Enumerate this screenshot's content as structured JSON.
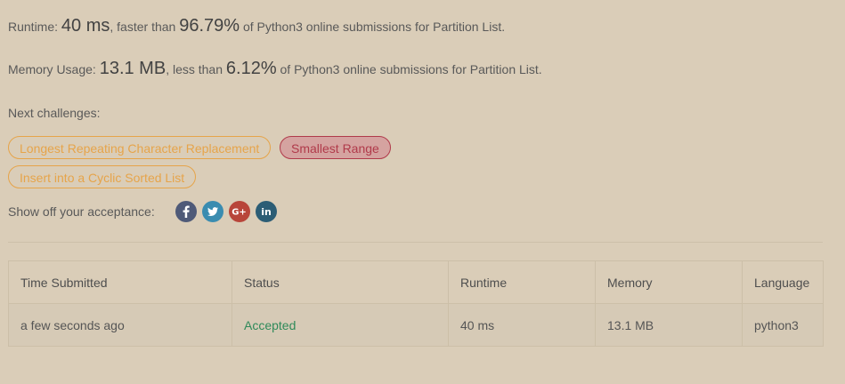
{
  "runtime_line": {
    "label": "Runtime:",
    "value": "40 ms",
    "mid": ", faster than",
    "percent": "96.79%",
    "suffix": "of Python3 online submissions for Partition List."
  },
  "memory_line": {
    "label": "Memory Usage:",
    "value": "13.1 MB",
    "mid": ", less than",
    "percent": "6.12%",
    "suffix": "of Python3 online submissions for Partition List."
  },
  "next": {
    "label": "Next challenges:",
    "challenges": [
      {
        "title": "Longest Repeating Character Replacement",
        "difficulty": "medium"
      },
      {
        "title": "Smallest Range",
        "difficulty": "hard"
      },
      {
        "title": "Insert into a Cyclic Sorted List",
        "difficulty": "medium"
      }
    ]
  },
  "share": {
    "label": "Show off your acceptance:",
    "icons": [
      "facebook-icon",
      "twitter-icon",
      "google-plus-icon",
      "linkedin-icon"
    ]
  },
  "table": {
    "headers": [
      "Time Submitted",
      "Status",
      "Runtime",
      "Memory",
      "Language"
    ],
    "rows": [
      [
        "a few seconds ago",
        "Accepted",
        "40 ms",
        "13.1 MB",
        "python3"
      ]
    ]
  },
  "colors": {
    "background": "#dacdb8",
    "medium": "#e6a44a",
    "hard": "#b03a4a",
    "accepted": "#2f8a5a"
  }
}
